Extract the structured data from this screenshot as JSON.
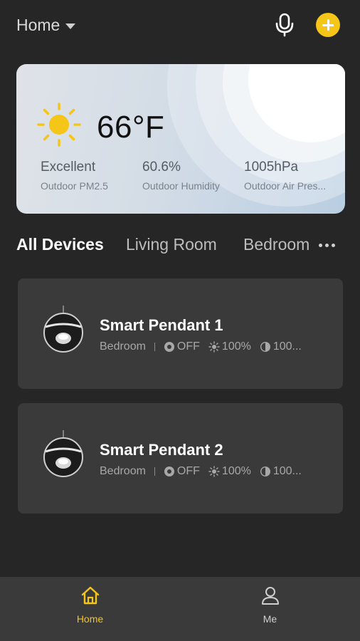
{
  "header": {
    "home_label": "Home",
    "accent_color": "#f5c518",
    "icons": [
      "caret-down-icon",
      "microphone-icon",
      "add-icon"
    ]
  },
  "weather": {
    "temperature": "66°F",
    "icon": "sun-icon",
    "stats": [
      {
        "value": "Excellent",
        "label": "Outdoor PM2.5"
      },
      {
        "value": "60.6%",
        "label": "Outdoor Humidity"
      },
      {
        "value": "1005hPa",
        "label": "Outdoor Air Pres..."
      }
    ]
  },
  "tabs": {
    "items": [
      "All Devices",
      "Living Room",
      "Bedroom"
    ],
    "active": "All Devices",
    "more_icon": "more-dots-icon"
  },
  "devices": [
    {
      "name": "Smart Pendant 1",
      "room": "Bedroom",
      "power": "OFF",
      "brightness": "100%",
      "color_temp": "100..."
    },
    {
      "name": "Smart Pendant 2",
      "room": "Bedroom",
      "power": "OFF",
      "brightness": "100%",
      "color_temp": "100..."
    }
  ],
  "bottom_nav": {
    "items": [
      {
        "label": "Home",
        "icon": "home-icon",
        "active": true
      },
      {
        "label": "Me",
        "icon": "user-icon",
        "active": false
      }
    ]
  }
}
